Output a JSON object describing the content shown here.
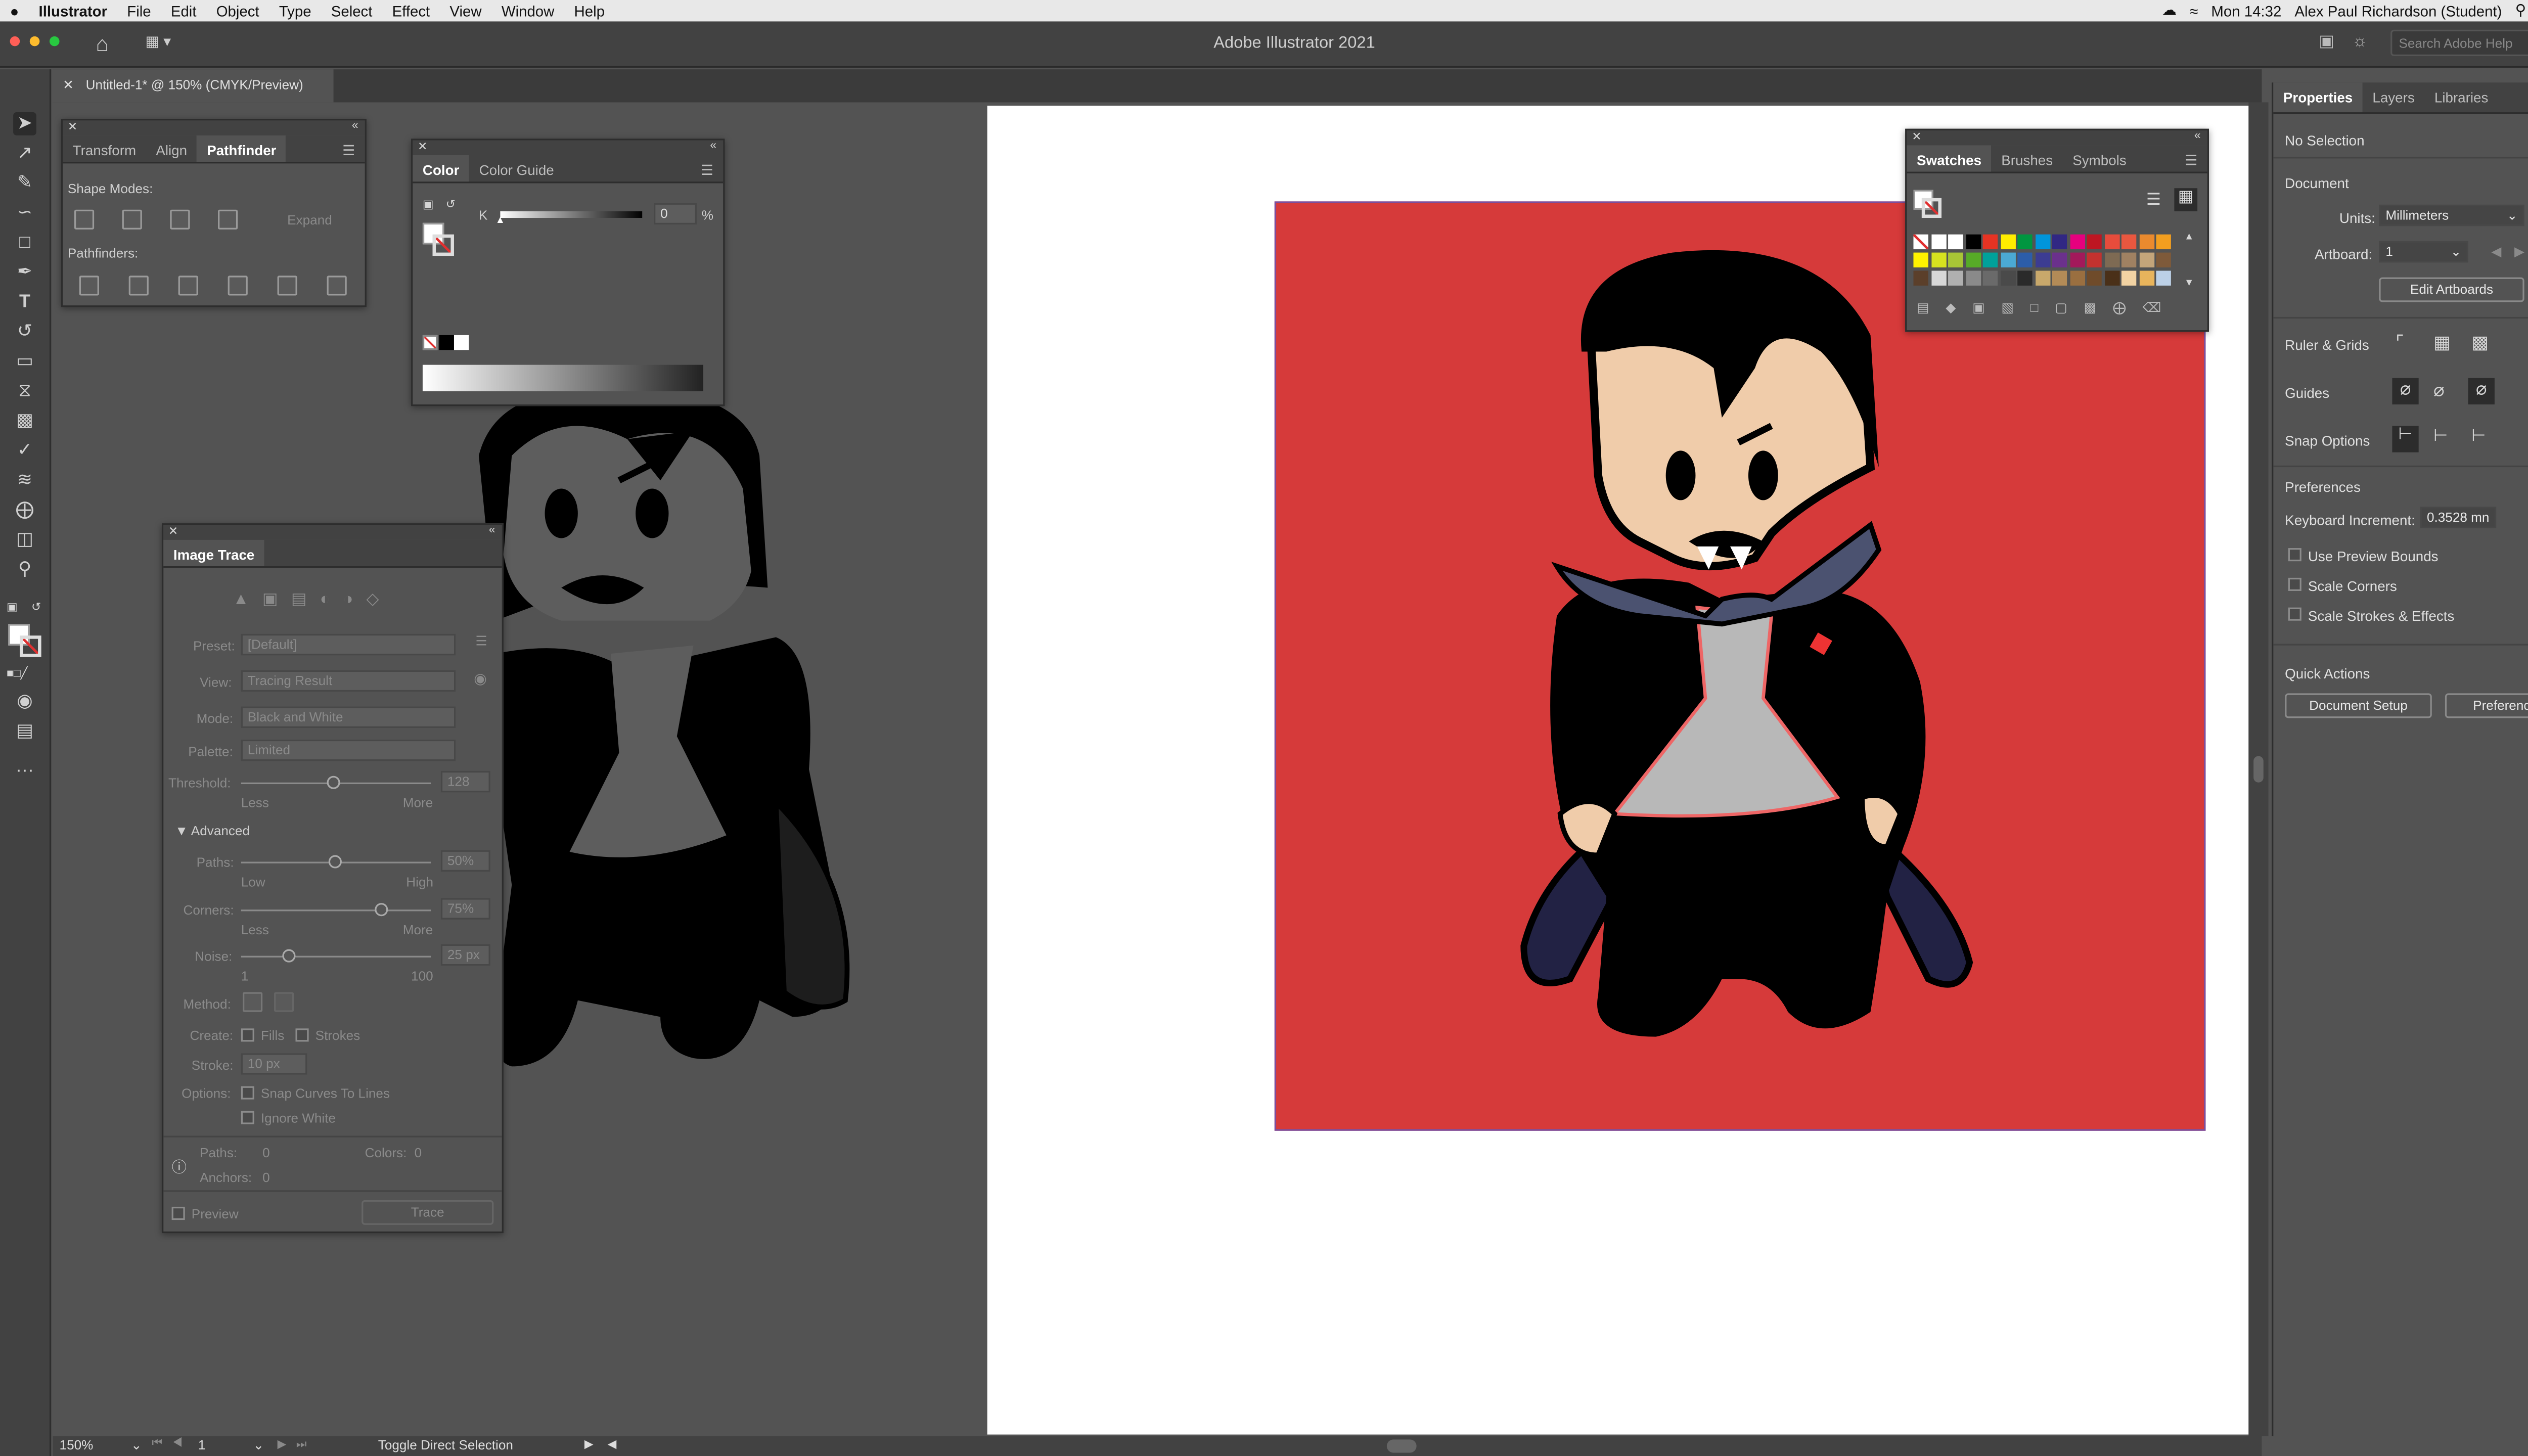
{
  "menubar": {
    "apple": "",
    "app": "Illustrator",
    "items": [
      "File",
      "Edit",
      "Object",
      "Type",
      "Select",
      "Effect",
      "View",
      "Window",
      "Help"
    ],
    "clock": "Mon 14:32",
    "user": "Alex Paul Richardson (Student)"
  },
  "appbar": {
    "title": "Adobe Illustrator 2021",
    "search_placeholder": "Search Adobe Help"
  },
  "document": {
    "tab_title": "Untitled-1* @ 150% (CMYK/Preview)"
  },
  "pathfinder_panel": {
    "tabs": [
      "Transform",
      "Align",
      "Pathfinder"
    ],
    "shape_modes_label": "Shape Modes:",
    "expand_label": "Expand",
    "pathfinders_label": "Pathfinders:"
  },
  "color_panel": {
    "tabs": [
      "Color",
      "Color Guide"
    ],
    "channel": "K",
    "value": "0",
    "unit": "%"
  },
  "image_trace": {
    "title": "Image Trace",
    "preset_label": "Preset:",
    "preset": "[Default]",
    "view_label": "View:",
    "view": "Tracing Result",
    "mode_label": "Mode:",
    "mode": "Black and White",
    "palette_label": "Palette:",
    "palette": "Limited",
    "threshold_label": "Threshold:",
    "threshold": "128",
    "threshold_less": "Less",
    "threshold_more": "More",
    "advanced_label": "Advanced",
    "paths_label": "Paths:",
    "paths_value": "50%",
    "paths_low": "Low",
    "paths_high": "High",
    "corners_label": "Corners:",
    "corners_value": "75%",
    "corners_less": "Less",
    "corners_more": "More",
    "noise_label": "Noise:",
    "noise_value": "25 px",
    "noise_min": "1",
    "noise_max": "100",
    "method_label": "Method:",
    "create_label": "Create:",
    "fills_label": "Fills",
    "strokes_label": "Strokes",
    "stroke_label": "Stroke:",
    "stroke_value": "10 px",
    "options_label": "Options:",
    "snap_label": "Snap Curves To Lines",
    "ignore_white_label": "Ignore White",
    "paths_count_label": "Paths:",
    "paths_count": "0",
    "colors_count_label": "Colors:",
    "colors_count": "0",
    "anchors_label": "Anchors:",
    "anchors_count": "0",
    "preview_label": "Preview",
    "trace_label": "Trace"
  },
  "swatches_panel": {
    "tabs": [
      "Swatches",
      "Brushes",
      "Symbols"
    ],
    "colors": [
      [
        "#ffffff",
        "#ffffff",
        "#ffffff",
        "#000000",
        "#e63323",
        "#ffed00",
        "#009640",
        "#0095db",
        "#312783",
        "#e6007e",
        "#be1622",
        "#e74c3c",
        "#e9573f",
        "#ea8a2e",
        "#f29e1f"
      ],
      [
        "#fff200",
        "#d6e21f",
        "#a8c536",
        "#57ab27",
        "#00a19a",
        "#4ba9d4",
        "#2c5da9",
        "#3c3c92",
        "#6b318c",
        "#a3195b",
        "#c3322f",
        "#7e6a53",
        "#a08162",
        "#c4a57a",
        "#7e5a3a"
      ],
      [
        "#5b3f2a",
        "#d7d7d7",
        "#b0b0b0",
        "#8a8a8a",
        "#6a6a6a",
        "#4a4a4a",
        "#2a2a2a",
        "#c8a86b",
        "#b38b57",
        "#9a6f40",
        "#6f4b2a",
        "#4a3018",
        "#f2d3a3",
        "#e8b45c",
        "#bcd0e6"
      ]
    ]
  },
  "properties": {
    "tabs": [
      "Properties",
      "Layers",
      "Libraries"
    ],
    "selection": "No Selection",
    "document_label": "Document",
    "units_label": "Units:",
    "units": "Millimeters",
    "artboard_label": "Artboard:",
    "artboard": "1",
    "edit_artboards": "Edit Artboards",
    "ruler_grids": "Ruler & Grids",
    "guides": "Guides",
    "snap_options": "Snap Options",
    "preferences_label": "Preferences",
    "keyboard_increment_label": "Keyboard Increment:",
    "keyboard_increment": "0.3528 mn",
    "use_preview_bounds": "Use Preview Bounds",
    "scale_corners": "Scale Corners",
    "scale_strokes": "Scale Strokes & Effects",
    "quick_actions": "Quick Actions",
    "document_setup": "Document Setup",
    "preferences_button": "Preferences"
  },
  "statusbar": {
    "zoom": "150%",
    "artboard": "1",
    "status": "Toggle Direct Selection"
  },
  "colors": {
    "accent": "#d63a3a",
    "panel": "#535353",
    "dark": "#424242"
  }
}
